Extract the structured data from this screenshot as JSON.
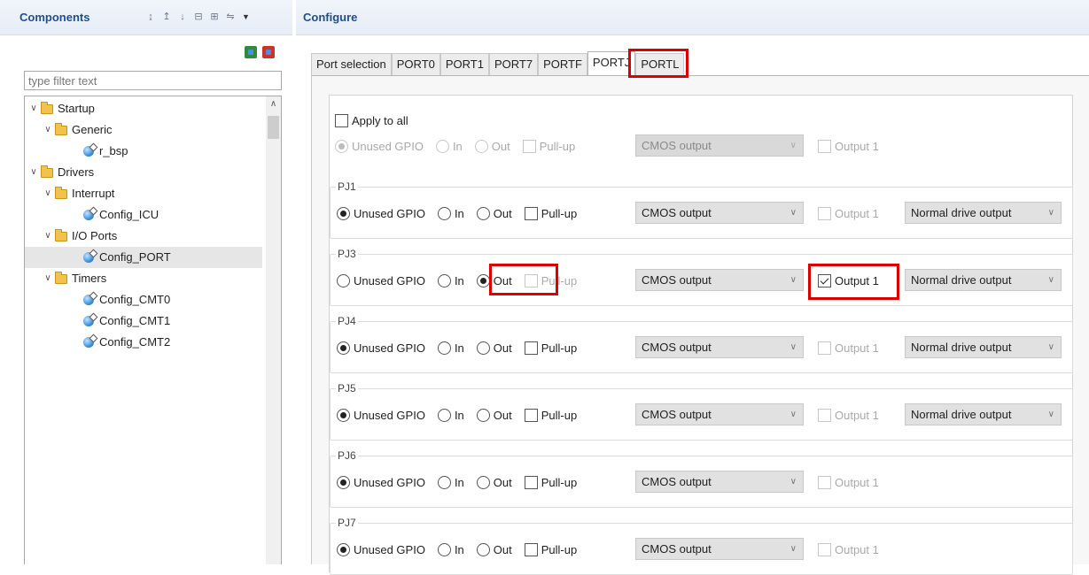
{
  "components": {
    "title": "Components",
    "filter_placeholder": "type filter text",
    "tree": {
      "startup": "Startup",
      "generic": "Generic",
      "r_bsp": "r_bsp",
      "drivers": "Drivers",
      "interrupt": "Interrupt",
      "config_icu": "Config_ICU",
      "io_ports": "I/O Ports",
      "config_port": "Config_PORT",
      "timers": "Timers",
      "config_cmt0": "Config_CMT0",
      "config_cmt1": "Config_CMT1",
      "config_cmt2": "Config_CMT2"
    }
  },
  "configure": {
    "title": "Configure",
    "tabs": [
      "Port selection",
      "PORT0",
      "PORT1",
      "PORT7",
      "PORTF",
      "PORTJ",
      "PORTL"
    ],
    "active_tab": "PORTJ",
    "labels": {
      "apply_all": "Apply to all",
      "unused_gpio": "Unused GPIO",
      "in": "In",
      "out": "Out",
      "pullup": "Pull-up",
      "cmos_output": "CMOS output",
      "output1": "Output 1",
      "normal_drive": "Normal drive output"
    },
    "pins": [
      {
        "name": "PJ1",
        "mode": "unused",
        "output1": false,
        "drive": true
      },
      {
        "name": "PJ3",
        "mode": "out",
        "output1": true,
        "drive": true
      },
      {
        "name": "PJ4",
        "mode": "unused",
        "output1": false,
        "drive": true
      },
      {
        "name": "PJ5",
        "mode": "unused",
        "output1": false,
        "drive": true
      },
      {
        "name": "PJ6",
        "mode": "unused",
        "output1": false,
        "drive": false
      },
      {
        "name": "PJ7",
        "mode": "unused",
        "output1": false,
        "drive": false
      }
    ]
  },
  "colors": {
    "header_text": "#1f4e8c",
    "highlight": "#dd0000"
  }
}
